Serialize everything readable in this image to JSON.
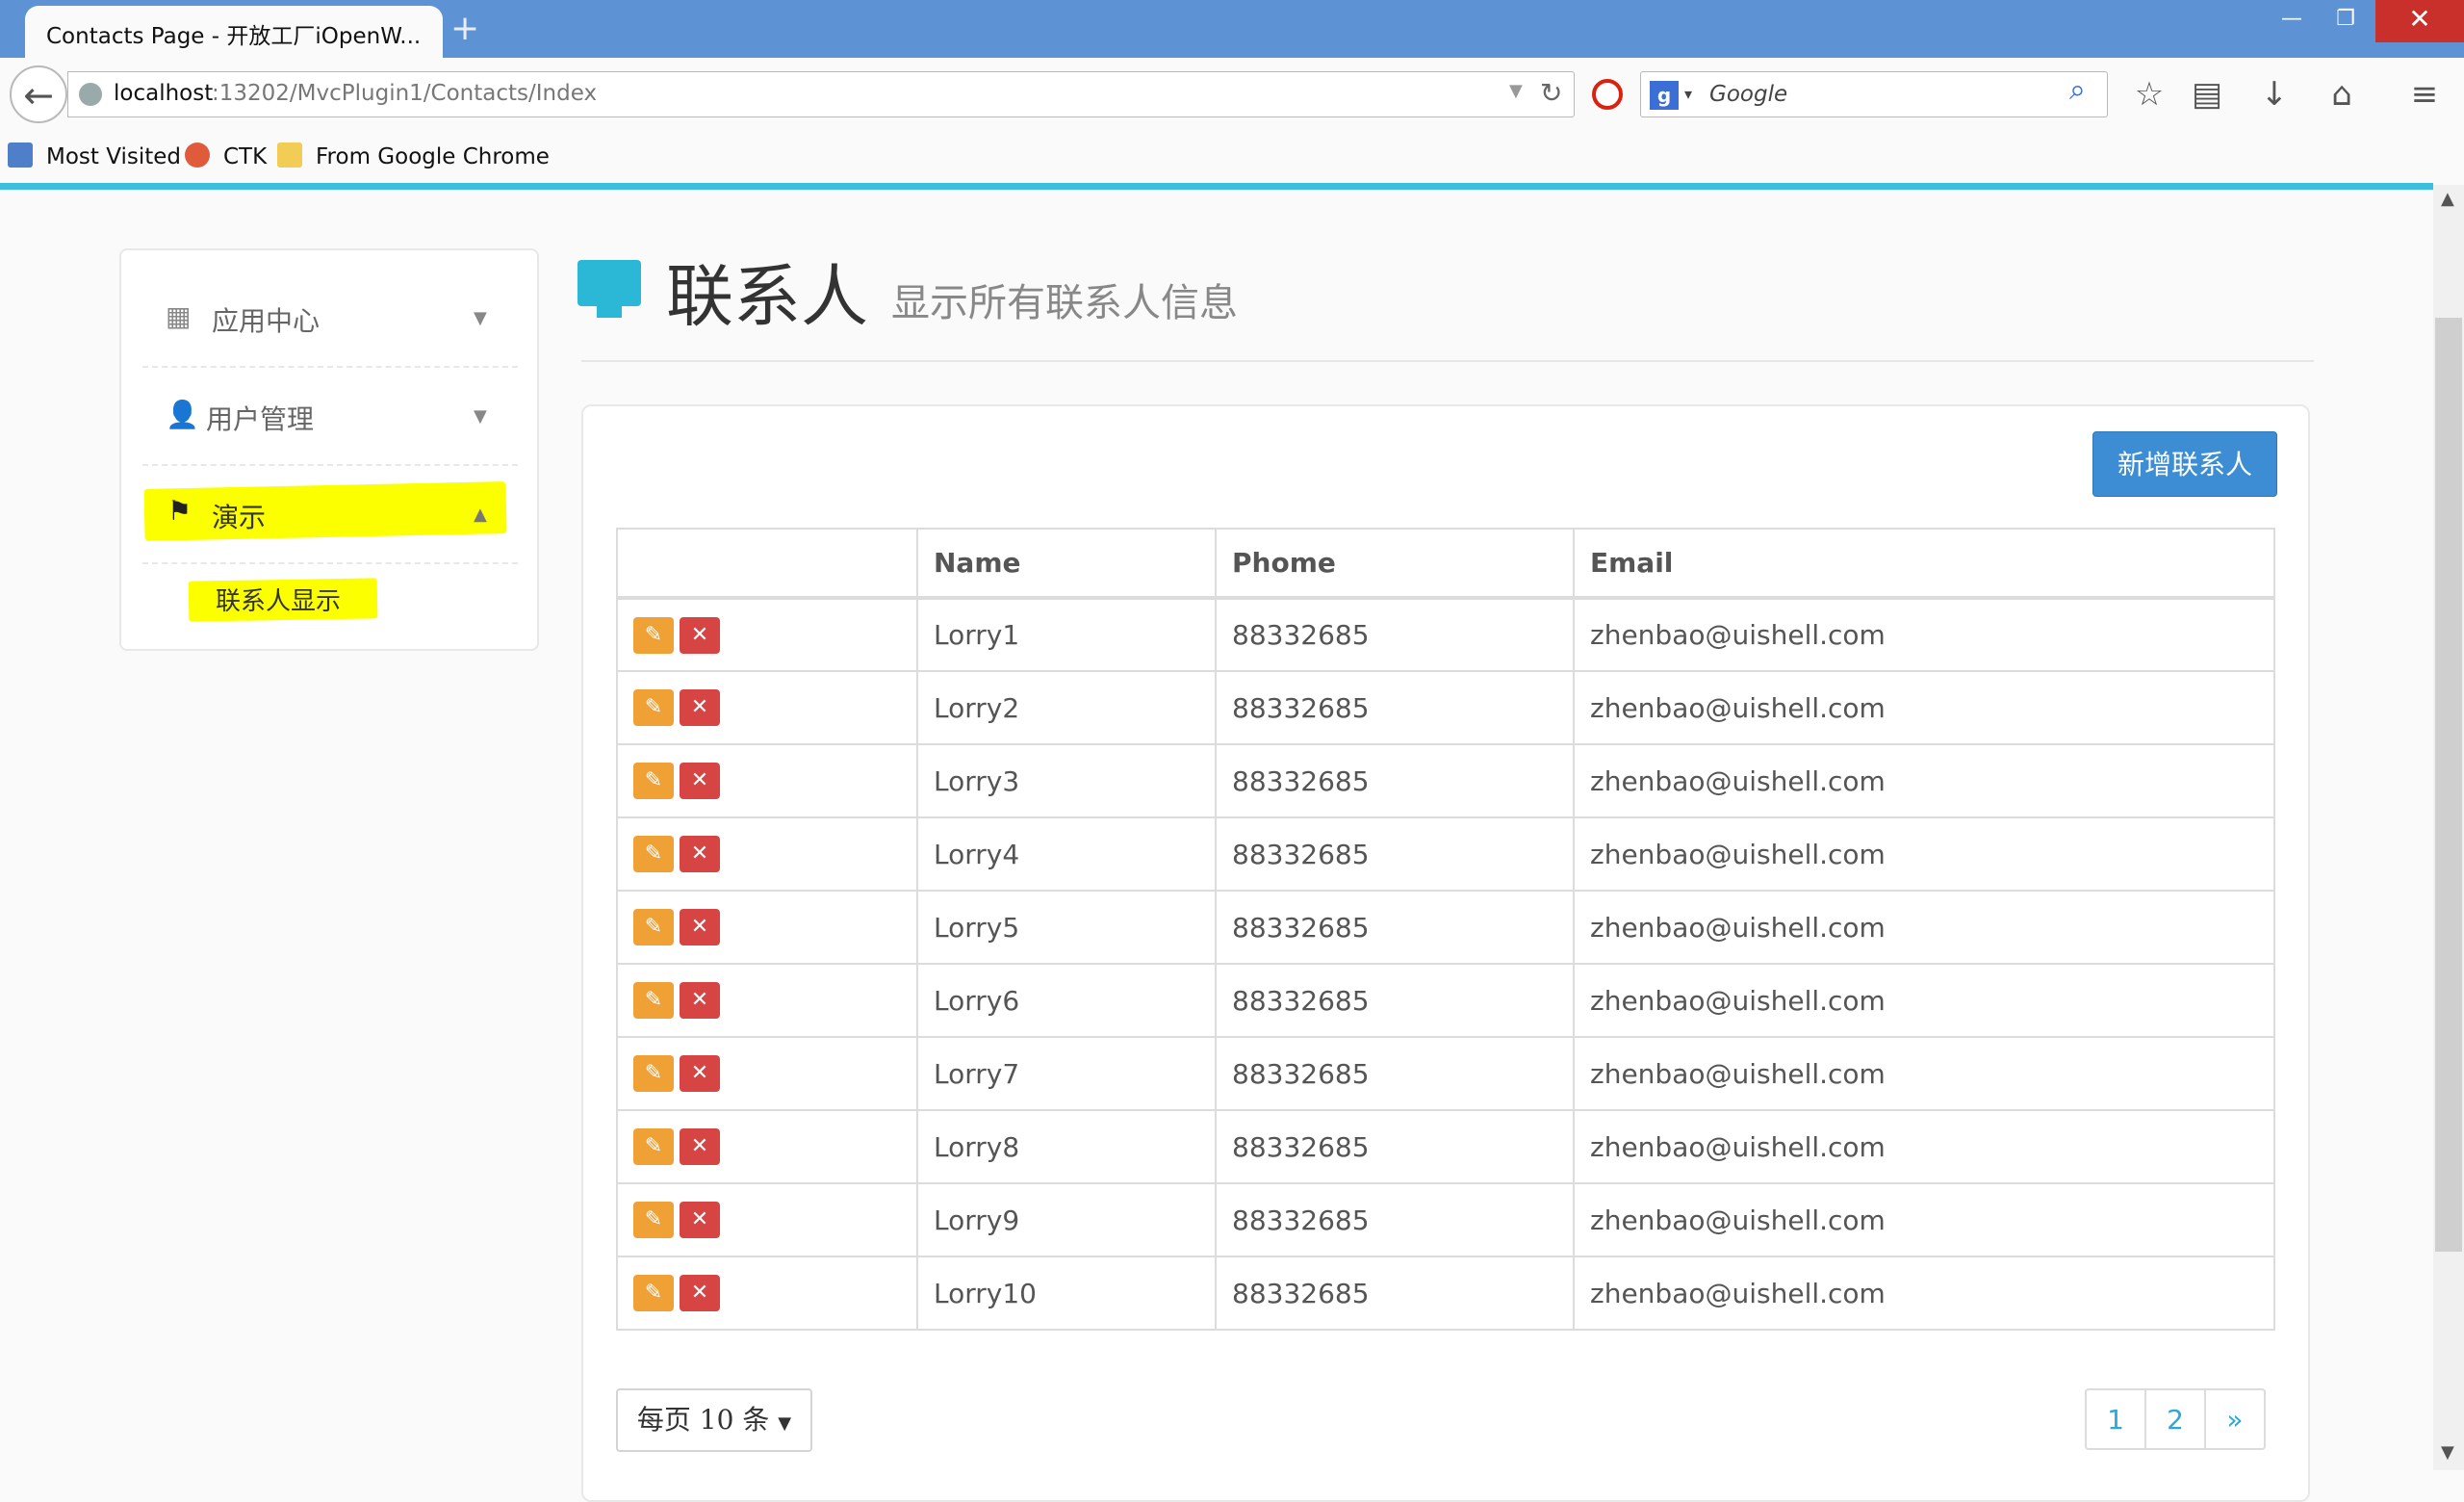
{
  "browser": {
    "tab_title": "Contacts Page - 开放工厂iOpenW...",
    "new_tab": "+",
    "win_min": "—",
    "win_max": "❐",
    "win_close": "✕",
    "url_host": "localhost",
    "url_path": ":13202/MvcPlugin1/Contacts/Index",
    "search_placeholder": "Google",
    "bookmarks": [
      "Most Visited",
      "CTK",
      "From Google Chrome"
    ]
  },
  "sidebar": {
    "items": [
      {
        "label": "应用中心",
        "icon": "grid-icon"
      },
      {
        "label": "用户管理",
        "icon": "user-icon"
      },
      {
        "label": "演示",
        "icon": "flag-icon"
      }
    ],
    "subitem": "联系人显示"
  },
  "page": {
    "title": "联系人",
    "subtitle": "显示所有联系人信息",
    "add_button": "新增联系人"
  },
  "table": {
    "headers": [
      "",
      "Name",
      "Phome",
      "Email"
    ],
    "rows": [
      {
        "name": "Lorry1",
        "phone": "88332685",
        "email": "zhenbao@uishell.com"
      },
      {
        "name": "Lorry2",
        "phone": "88332685",
        "email": "zhenbao@uishell.com"
      },
      {
        "name": "Lorry3",
        "phone": "88332685",
        "email": "zhenbao@uishell.com"
      },
      {
        "name": "Lorry4",
        "phone": "88332685",
        "email": "zhenbao@uishell.com"
      },
      {
        "name": "Lorry5",
        "phone": "88332685",
        "email": "zhenbao@uishell.com"
      },
      {
        "name": "Lorry6",
        "phone": "88332685",
        "email": "zhenbao@uishell.com"
      },
      {
        "name": "Lorry7",
        "phone": "88332685",
        "email": "zhenbao@uishell.com"
      },
      {
        "name": "Lorry8",
        "phone": "88332685",
        "email": "zhenbao@uishell.com"
      },
      {
        "name": "Lorry9",
        "phone": "88332685",
        "email": "zhenbao@uishell.com"
      },
      {
        "name": "Lorry10",
        "phone": "88332685",
        "email": "zhenbao@uishell.com"
      }
    ]
  },
  "pagination": {
    "page_size": "每页 10 条",
    "pages": [
      "1",
      "2",
      "»"
    ]
  },
  "colors": {
    "accent": "#3c8dd4",
    "edit": "#f0a135",
    "delete": "#d64444",
    "highlight": "#fbff00",
    "link": "#2ba8d6"
  }
}
